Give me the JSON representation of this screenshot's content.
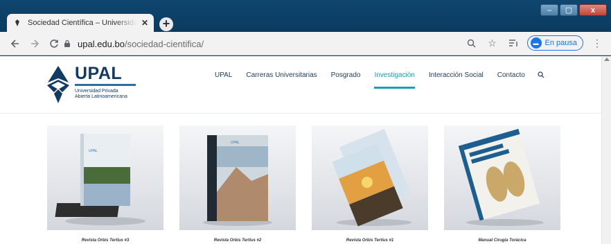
{
  "browser": {
    "tab_title": "Sociedad Científica – Universidad",
    "url_host": "upal.edu.bo",
    "url_path": "/sociedad-cientifica/",
    "profile_status": "En pausa",
    "window_close": "x"
  },
  "site": {
    "brand": "UPAL",
    "brand_sub_line1": "Universidad Privada",
    "brand_sub_line2": "Abierta Latinoamericana",
    "nav": [
      "UPAL",
      "Carreras Universitarias",
      "Posgrado",
      "Investigación",
      "Interacción Social",
      "Contacto"
    ],
    "active_nav": "Investigación"
  },
  "publications": [
    {
      "title": "Revista Orbis Tertius #3"
    },
    {
      "title": "Revista Orbis Tertius #2"
    },
    {
      "title": "Revista Orbis Tertius #1"
    },
    {
      "title": "Manual Cirugía Torácica"
    }
  ],
  "colors": {
    "frame": "#0d3d63",
    "brand": "#123a63",
    "accent": "#19a0b2"
  }
}
